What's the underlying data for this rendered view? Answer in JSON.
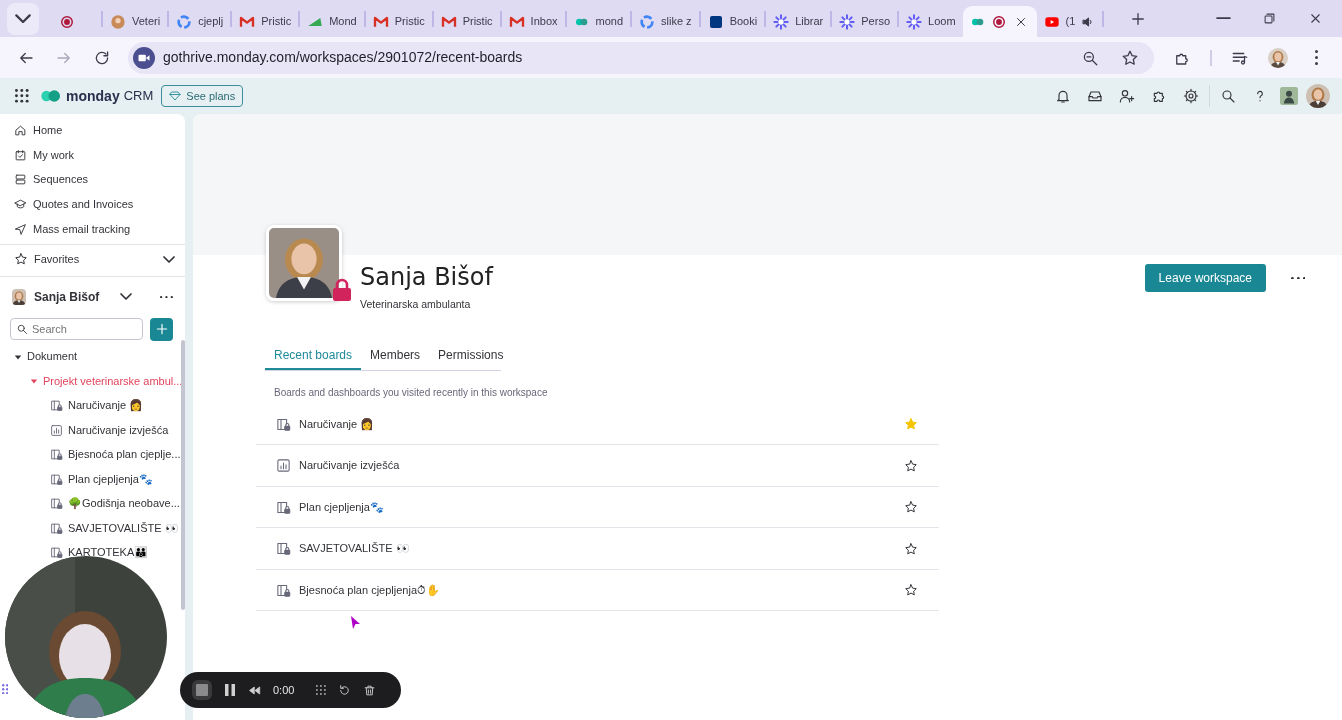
{
  "browser": {
    "tabs": [
      {
        "kind": "blank",
        "recording": true,
        "selected": false,
        "audio": false
      },
      {
        "kind": "avatar",
        "title": "Veteri",
        "recording": false,
        "selected": false,
        "audio": false
      },
      {
        "kind": "ring",
        "title": "cjeplj",
        "recording": false,
        "selected": false,
        "audio": false
      },
      {
        "kind": "mail",
        "title": "Pristic",
        "recording": false,
        "selected": false,
        "audio": false
      },
      {
        "kind": "triangle",
        "title": "Mond",
        "recording": false,
        "selected": false,
        "audio": false
      },
      {
        "kind": "mail",
        "title": "Pristic",
        "recording": false,
        "selected": false,
        "audio": false
      },
      {
        "kind": "mail",
        "title": "Pristic",
        "recording": false,
        "selected": false,
        "audio": false
      },
      {
        "kind": "mail",
        "title": "Inbox",
        "recording": false,
        "selected": false,
        "audio": false
      },
      {
        "kind": "blob",
        "title": "mond",
        "recording": false,
        "selected": false,
        "audio": false
      },
      {
        "kind": "ring",
        "title": "slike z",
        "recording": false,
        "selected": false,
        "audio": false
      },
      {
        "kind": "square",
        "title": "Booki",
        "recording": false,
        "selected": false,
        "audio": false
      },
      {
        "kind": "flower",
        "title": "Librar",
        "recording": false,
        "selected": false,
        "audio": false
      },
      {
        "kind": "flower",
        "title": "Perso",
        "recording": false,
        "selected": false,
        "audio": false
      },
      {
        "kind": "flower",
        "title": "Loom",
        "recording": false,
        "selected": false,
        "audio": false
      },
      {
        "kind": "blob",
        "recording": true,
        "selected": true,
        "audio": false
      },
      {
        "kind": "play",
        "title": "(1",
        "recording": false,
        "selected": false,
        "audio": true
      }
    ],
    "address": "gothrive.monday.com/workspaces/2901072/recent-boards"
  },
  "app": {
    "logo": "monday",
    "product": "CRM",
    "plans_button": "See plans"
  },
  "sidebar": {
    "nav": [
      {
        "kind": "home",
        "label": "Home"
      },
      {
        "kind": "mywork",
        "label": "My work"
      },
      {
        "kind": "sequences",
        "label": "Sequences"
      },
      {
        "kind": "quotes",
        "label": "Quotes and Invoices"
      },
      {
        "kind": "send",
        "label": "Mass email tracking"
      }
    ],
    "favorites": {
      "label": "Favorites",
      "expanded": false
    },
    "workspace": {
      "name": "Sanja Bišof"
    },
    "search": {
      "placeholder": "Search"
    },
    "tree": [
      {
        "label": "Dokument",
        "expanded": true,
        "children": [
          {
            "label": "Projekt veterinarske ambul...",
            "expanded": true,
            "children": [
              {
                "kind": "board",
                "label": "Naručivanje 👩"
              },
              {
                "kind": "dashboard",
                "label": "Naručivanje izvješća"
              },
              {
                "kind": "board",
                "label": "Bjesnoća plan cjeplje..."
              },
              {
                "kind": "board",
                "label": "Plan cjepljenja🐾"
              },
              {
                "kind": "board",
                "label": "🌳Godišnja neobave..."
              },
              {
                "kind": "board",
                "label": "SAVJETOVALIŠTE 👀"
              },
              {
                "kind": "board",
                "label": "KARTOTEKA👪"
              }
            ]
          }
        ]
      }
    ]
  },
  "workspace": {
    "name": "Sanja Bišof",
    "subtitle": "Veterinarska ambulanta",
    "leave_button": "Leave workspace",
    "tabs": [
      {
        "label": "Recent boards",
        "selected": true
      },
      {
        "label": "Members",
        "selected": false
      },
      {
        "label": "Permissions",
        "selected": false
      }
    ],
    "description": "Boards and dashboards you visited recently in this workspace",
    "boards": [
      {
        "kind": "board",
        "name": "Naručivanje 👩",
        "starred": true
      },
      {
        "kind": "dashboard",
        "name": "Naručivanje izvješća",
        "starred": false
      },
      {
        "kind": "board",
        "name": "Plan cjepljenja🐾",
        "starred": false
      },
      {
        "kind": "board",
        "name": "SAVJETOVALIŠTE 👀",
        "starred": false
      },
      {
        "kind": "board",
        "name": "Bjesnoća plan cjepljenja⏱✋",
        "starred": false
      }
    ]
  },
  "recorder": {
    "time": "0:00"
  }
}
